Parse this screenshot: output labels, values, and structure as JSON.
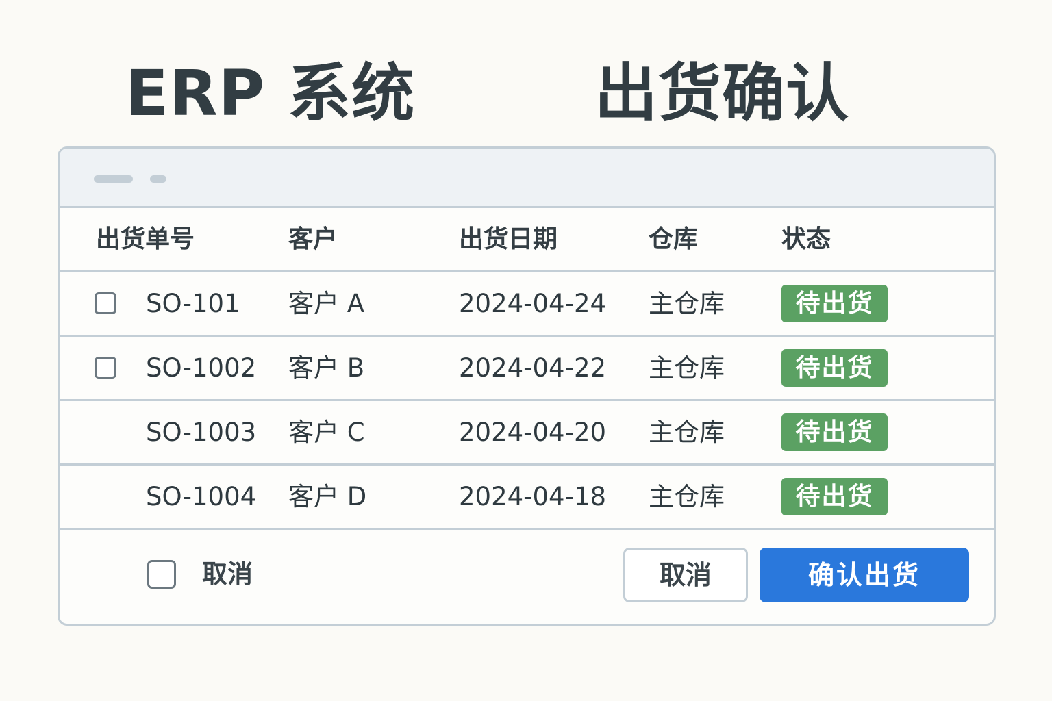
{
  "page": {
    "title_left": "ERP 系统",
    "title_right": "出货确认"
  },
  "table": {
    "headers": {
      "no": "出货单号",
      "customer": "客户",
      "date": "出货日期",
      "warehouse": "仓库",
      "status": "状态"
    },
    "rows": [
      {
        "checkbox": true,
        "no": "SO-101",
        "customer": "客户 A",
        "date": "2024-04-24",
        "warehouse": "主仓库",
        "status": "待出货"
      },
      {
        "checkbox": true,
        "no": "SO-1002",
        "customer": "客户 B",
        "date": "2024-04-22",
        "warehouse": "主仓库",
        "status": "待出货"
      },
      {
        "checkbox": false,
        "no": "SO-1003",
        "customer": "客户 C",
        "date": "2024-04-20",
        "warehouse": "主仓库",
        "status": "待出货"
      },
      {
        "checkbox": false,
        "no": "SO-1004",
        "customer": "客户 D",
        "date": "2024-04-18",
        "warehouse": "主仓库",
        "status": "待出货"
      }
    ]
  },
  "footer": {
    "checkbox_label": "取消",
    "cancel_button": "取消",
    "confirm_button": "确认出货"
  },
  "colors": {
    "status_badge": "#5ba163",
    "primary_button": "#2a78dc",
    "border": "#c3ced6"
  }
}
